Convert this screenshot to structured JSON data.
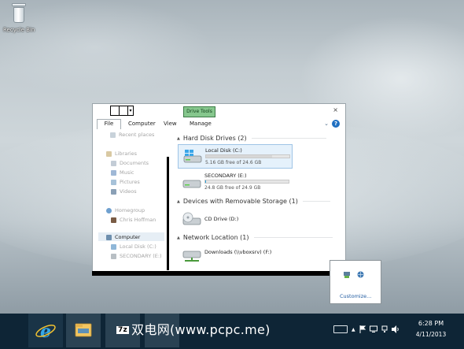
{
  "desktop": {
    "recycle_bin_label": "Recycle Bin"
  },
  "window": {
    "drive_tools_tab": "Drive Tools",
    "close_glyph": "×",
    "qat_dropdown_glyph": "▾",
    "ribbon_tabs": [
      "File",
      "Computer",
      "View",
      "Manage"
    ],
    "expand_ribbon_glyph": "⌄",
    "help_glyph": "?",
    "nav": {
      "recent_places": "Recent places",
      "libraries": "Libraries",
      "documents": "Documents",
      "music": "Music",
      "pictures": "Pictures",
      "videos": "Videos",
      "homegroup": "Homegroup",
      "chris_hoffman": "Chris Hoffman",
      "computer": "Computer",
      "local_disk": "Local Disk (C:)",
      "secondary": "SECONDARY (E:)"
    },
    "groups": {
      "hdd": "Hard Disk Drives (2)",
      "removable": "Devices with Removable Storage (1)",
      "network": "Network Location (1)"
    },
    "drives": {
      "c": {
        "name": "Local Disk (C:)",
        "free": "5.16 GB free of 24.6 GB",
        "used_fraction": 0.79
      },
      "e": {
        "name": "SECONDARY (E:)",
        "free": "24.8 GB free of 24.9 GB",
        "used_fraction": 0.01
      },
      "d": {
        "name": "CD Drive (D:)"
      },
      "f": {
        "name": "Downloads (\\\\vboxsrv) (F:)"
      }
    },
    "group_caret": "▲"
  },
  "tray_popup": {
    "customize": "Customize..."
  },
  "taskbar": {
    "watermark_box": "7z",
    "watermark_text": "双电网(www.pcpc.me)",
    "tray_arrow": "▲",
    "time": "6:28 PM",
    "date": "4/11/2013"
  },
  "colors": {
    "taskbar": "#0e2536",
    "drive_tools_green": "#86c78d",
    "progress_blue": "#26a0da",
    "selection_blue": "#e5f1fb"
  }
}
